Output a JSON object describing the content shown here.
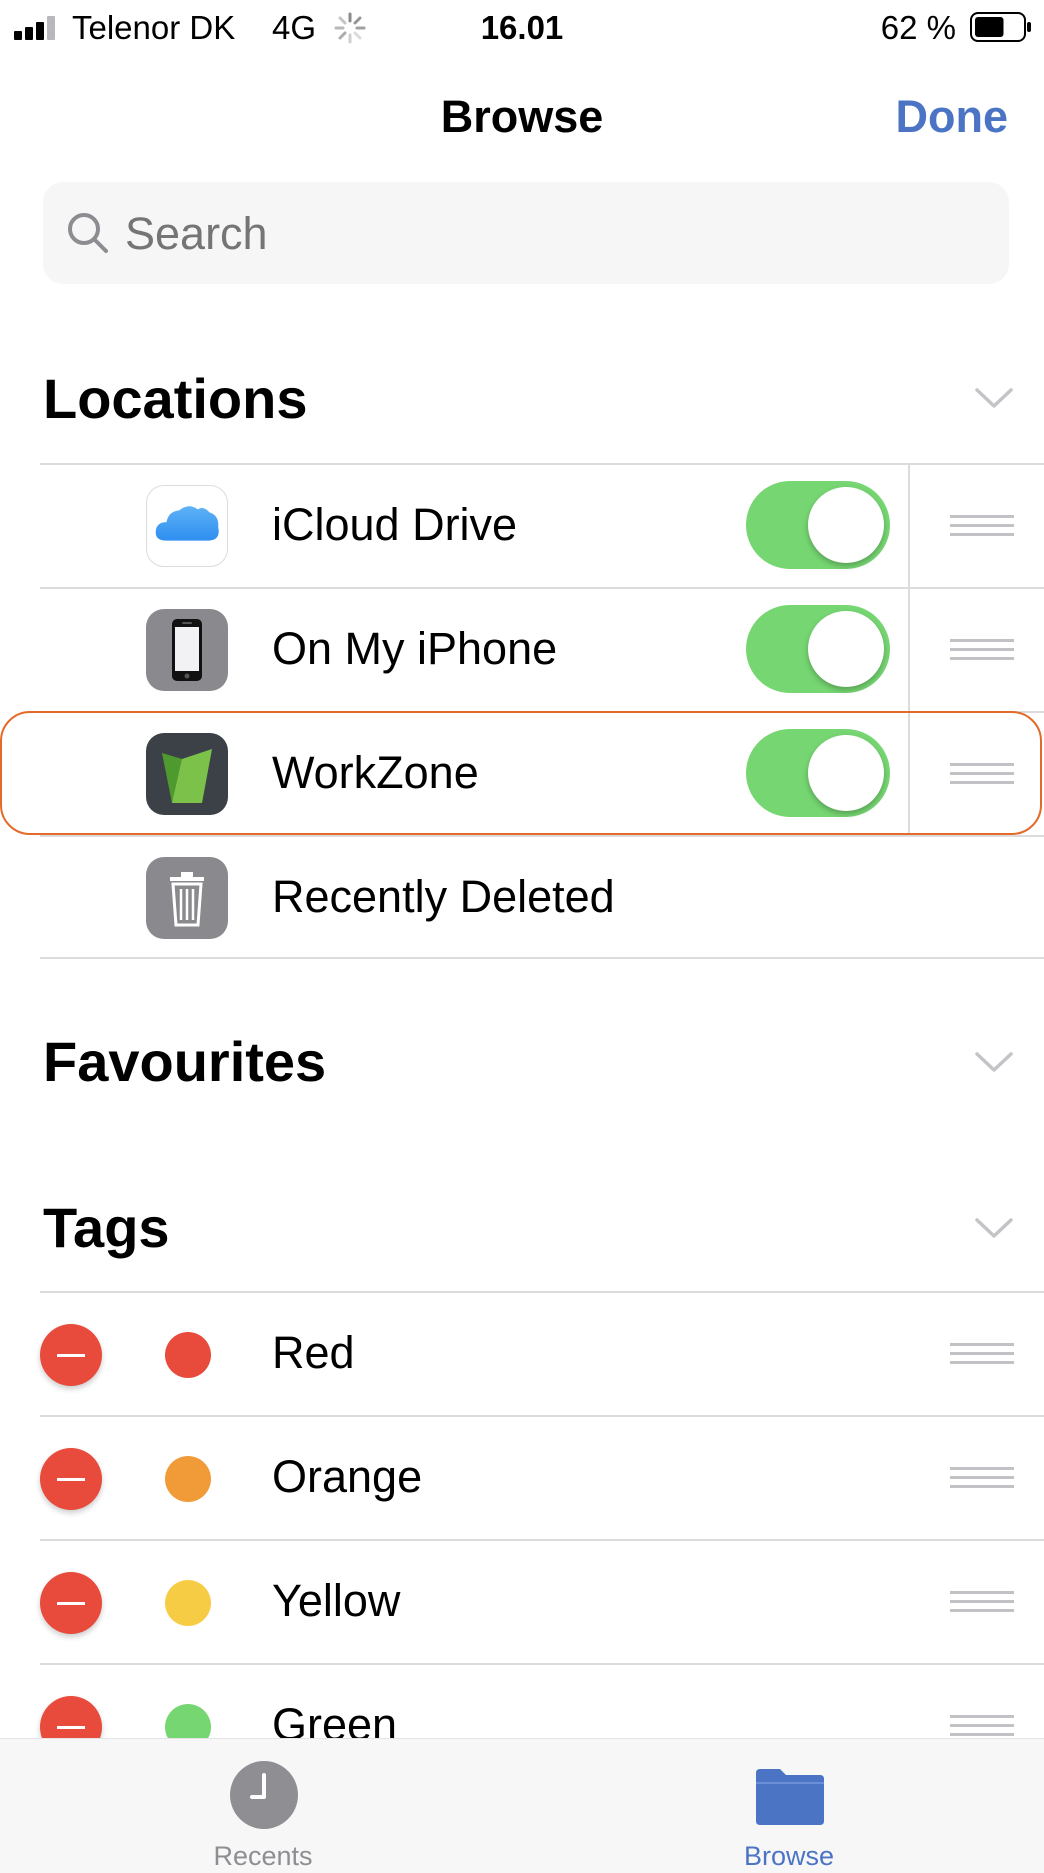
{
  "status_bar": {
    "carrier": "Telenor DK",
    "network": "4G",
    "time": "16.01",
    "battery_percent": "62 %",
    "battery_level": 0.62
  },
  "nav": {
    "title": "Browse",
    "done_label": "Done"
  },
  "search": {
    "placeholder": "Search"
  },
  "locations": {
    "title": "Locations",
    "items": [
      {
        "label": "iCloud Drive",
        "icon": "icloud-icon",
        "enabled": true
      },
      {
        "label": "On My iPhone",
        "icon": "iphone-icon",
        "enabled": true
      },
      {
        "label": "WorkZone",
        "icon": "workzone-icon",
        "enabled": true
      },
      {
        "label": "Recently Deleted",
        "icon": "trash-icon"
      }
    ]
  },
  "favourites": {
    "title": "Favourites"
  },
  "tags": {
    "title": "Tags",
    "items": [
      {
        "label": "Red",
        "color": "#e84b3b"
      },
      {
        "label": "Orange",
        "color": "#f19a38"
      },
      {
        "label": "Yellow",
        "color": "#f7cc45"
      },
      {
        "label": "Green",
        "color": "#76d672"
      }
    ]
  },
  "colors": {
    "accent": "#4c74c4",
    "toggle_on": "#76d672",
    "delete": "#e84b3b",
    "highlight_outline": "#e46a2a"
  },
  "tab_bar": {
    "tabs": [
      {
        "label": "Recents",
        "icon": "clock-icon",
        "selected": false
      },
      {
        "label": "Browse",
        "icon": "folder-icon",
        "selected": true
      }
    ]
  }
}
